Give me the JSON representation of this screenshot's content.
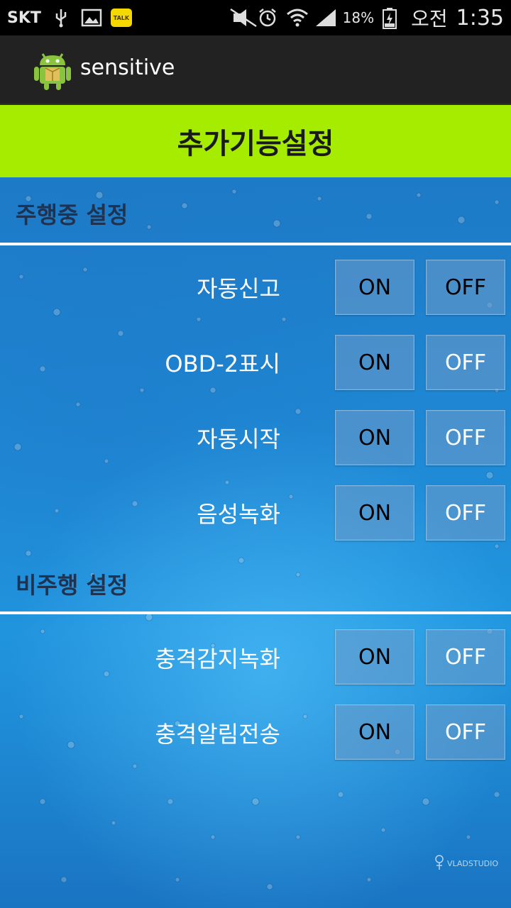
{
  "status_bar": {
    "carrier": "SKT",
    "battery": "18%",
    "ampm": "오전",
    "time": "1:35",
    "talk_badge": "TALK",
    "icons": [
      "usb-icon",
      "image-icon",
      "kakaotalk-icon",
      "mute-icon",
      "alarm-icon",
      "wifi-icon",
      "signal-icon",
      "battery-icon"
    ]
  },
  "action_bar": {
    "app_title": "sensitive",
    "app_icon": "android-icon"
  },
  "header": {
    "title": "추가기능설정"
  },
  "sections": [
    {
      "title": "주행중 설정",
      "rows": [
        {
          "label": "자동신고",
          "on": "ON",
          "off": "OFF"
        },
        {
          "label": "OBD-2표시",
          "on": "ON",
          "off": "OFF"
        },
        {
          "label": "자동시작",
          "on": "ON",
          "off": "OFF"
        },
        {
          "label": "음성녹화",
          "on": "ON",
          "off": "OFF"
        }
      ]
    },
    {
      "title": "비주행 설정",
      "rows": [
        {
          "label": "충격감지녹화",
          "on": "ON",
          "off": "OFF"
        },
        {
          "label": "충격알림전송",
          "on": "ON",
          "off": "OFF"
        }
      ]
    }
  ],
  "watermark": "VLADSTUDIO",
  "colors": {
    "header_green": "#a6ec00",
    "action_bar": "#222222",
    "background_blue": "#1f8ad6"
  }
}
